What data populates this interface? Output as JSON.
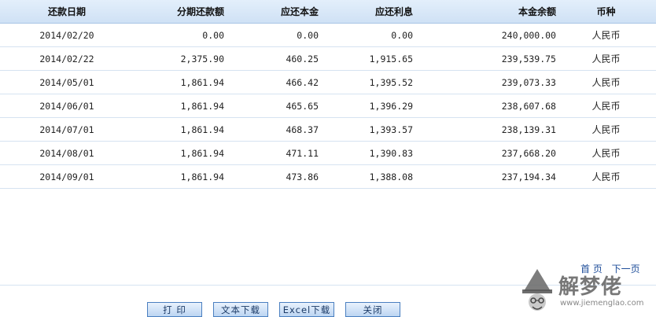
{
  "table": {
    "headers": [
      "还款日期",
      "分期还款额",
      "应还本金",
      "应还利息",
      "本金余额",
      "币种"
    ],
    "rows": [
      [
        "2014/02/20",
        "0.00",
        "0.00",
        "0.00",
        "240,000.00",
        "人民币"
      ],
      [
        "2014/02/22",
        "2,375.90",
        "460.25",
        "1,915.65",
        "239,539.75",
        "人民币"
      ],
      [
        "2014/05/01",
        "1,861.94",
        "466.42",
        "1,395.52",
        "239,073.33",
        "人民币"
      ],
      [
        "2014/06/01",
        "1,861.94",
        "465.65",
        "1,396.29",
        "238,607.68",
        "人民币"
      ],
      [
        "2014/07/01",
        "1,861.94",
        "468.37",
        "1,393.57",
        "238,139.31",
        "人民币"
      ],
      [
        "2014/08/01",
        "1,861.94",
        "471.11",
        "1,390.83",
        "237,668.20",
        "人民币"
      ],
      [
        "2014/09/01",
        "1,861.94",
        "473.86",
        "1,388.08",
        "237,194.34",
        "人民币"
      ]
    ]
  },
  "pager": {
    "first": "首 页",
    "next": "下一页"
  },
  "buttons": {
    "print": "打 印",
    "text_download": "文本下载",
    "excel_download": "Excel下载",
    "close": "关闭"
  },
  "watermark": {
    "text": "解梦佬",
    "url": "www.jiemenglao.com"
  },
  "colors": {
    "header_bg": "#cfe1f5",
    "row_border": "#d6e3f1",
    "button_border": "#4a7fc0",
    "link": "#1f4e9a"
  },
  "icons": {
    "watermark_logo": "wizard-hat-face-icon"
  }
}
